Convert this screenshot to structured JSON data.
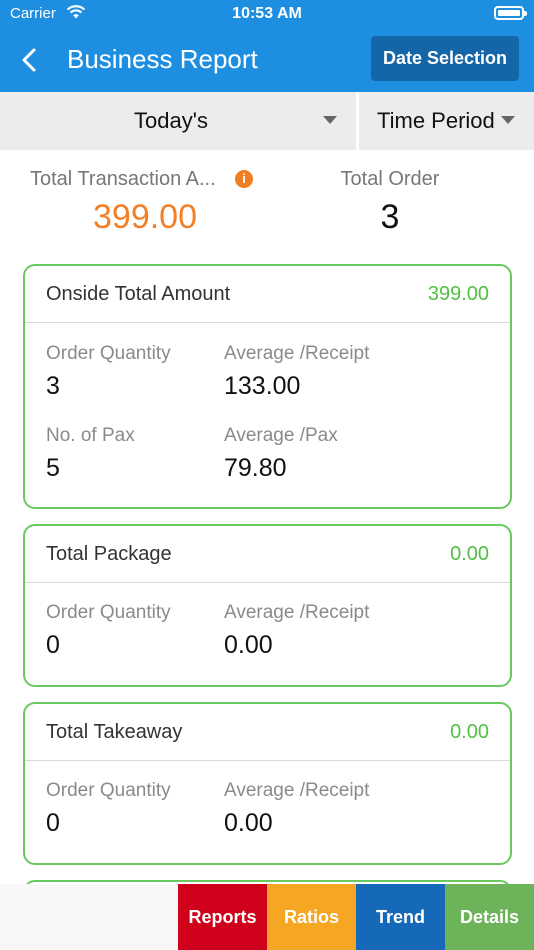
{
  "status_bar": {
    "carrier": "Carrier",
    "time": "10:53 AM",
    "icons": [
      "wifi-icon",
      "battery-icon"
    ]
  },
  "header": {
    "title": "Business Report",
    "back_icon": "chevron-left-icon",
    "date_button": "Date Selection",
    "background_color": "#1e8fe0",
    "button_color": "#1566a8"
  },
  "filters": {
    "period": "Today's",
    "time_period": "Time Period"
  },
  "summary": {
    "total_transaction_label": "Total Transaction A...",
    "total_transaction_value": "399.00",
    "info_icon": "i",
    "total_order_label": "Total Order",
    "total_order_value": "3",
    "accent_color": "#f37f26"
  },
  "cards": [
    {
      "name": "Onside Total Amount",
      "amount": "399.00",
      "metrics": [
        {
          "label": "Order Quantity",
          "value": "3"
        },
        {
          "label": "Average /Receipt",
          "value": "133.00"
        },
        {
          "label": "No. of Pax",
          "value": "5"
        },
        {
          "label": "Average /Pax",
          "value": "79.80"
        }
      ]
    },
    {
      "name": "Total Package",
      "amount": "0.00",
      "metrics": [
        {
          "label": "Order Quantity",
          "value": "0"
        },
        {
          "label": "Average /Receipt",
          "value": "0.00"
        }
      ]
    },
    {
      "name": "Total Takeaway",
      "amount": "0.00",
      "metrics": [
        {
          "label": "Order Quantity",
          "value": "0"
        },
        {
          "label": "Average /Receipt",
          "value": "0.00"
        }
      ]
    }
  ],
  "card_border_color": "#69c95f",
  "tabs": [
    {
      "label": "Reports",
      "color": "#d0021b"
    },
    {
      "label": "Ratios",
      "color": "#f5a623"
    },
    {
      "label": "Trend",
      "color": "#1669b8"
    },
    {
      "label": "Details",
      "color": "#6db35a"
    }
  ]
}
